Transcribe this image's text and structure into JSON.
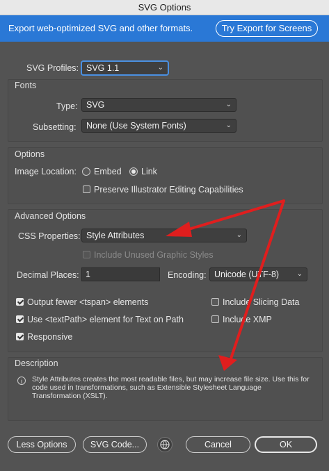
{
  "window": {
    "title": "SVG Options"
  },
  "banner": {
    "text": "Export web-optimized SVG and other formats.",
    "button": "Try Export for Screens"
  },
  "profiles": {
    "label": "SVG Profiles:",
    "value": "SVG 1.1"
  },
  "fonts": {
    "title": "Fonts",
    "type_label": "Type:",
    "type_value": "SVG",
    "subsetting_label": "Subsetting:",
    "subsetting_value": "None (Use System Fonts)"
  },
  "options": {
    "title": "Options",
    "image_location_label": "Image Location:",
    "embed": "Embed",
    "link": "Link",
    "selected_location": "Link",
    "preserve": "Preserve Illustrator Editing Capabilities"
  },
  "advanced": {
    "title": "Advanced Options",
    "css_label": "CSS Properties:",
    "css_value": "Style Attributes",
    "include_unused": "Include Unused Graphic Styles",
    "decimal_label": "Decimal Places:",
    "decimal_value": "1",
    "encoding_label": "Encoding:",
    "encoding_value": "Unicode (UTF-8)",
    "tspan": "Output fewer <tspan> elements",
    "textpath": "Use <textPath> element for Text on Path",
    "responsive": "Responsive",
    "slicing": "Include Slicing Data",
    "xmp": "Include XMP"
  },
  "description": {
    "title": "Description",
    "text": "Style Attributes creates the most readable files, but may increase file size. Use this for code used in transformations, such as Extensible Stylesheet Language Transformation (XSLT)."
  },
  "footer": {
    "less_options": "Less Options",
    "svg_code": "SVG Code...",
    "cancel": "Cancel",
    "ok": "OK"
  },
  "colors": {
    "banner": "#2a78d6",
    "annotation_arrow": "#e01e1e"
  }
}
